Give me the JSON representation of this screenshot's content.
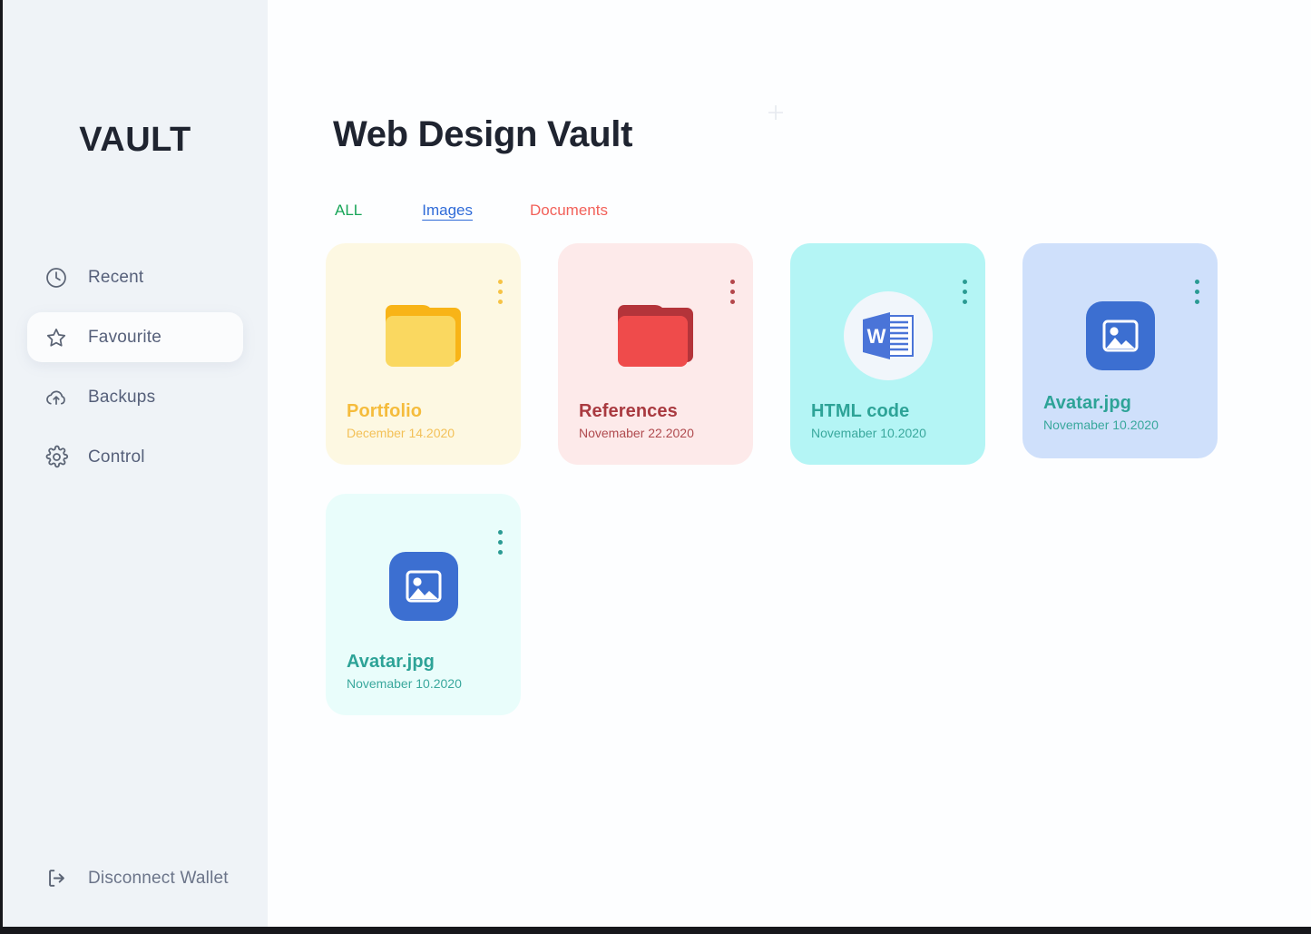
{
  "sidebar": {
    "brand": "VAULT",
    "items": [
      {
        "label": "Recent",
        "icon": "clock-icon",
        "active": false
      },
      {
        "label": "Favourite",
        "icon": "star-icon",
        "active": true
      },
      {
        "label": "Backups",
        "icon": "cloud-upload-icon",
        "active": false
      },
      {
        "label": "Control",
        "icon": "gear-icon",
        "active": false
      }
    ],
    "logout": {
      "label": "Disconnect Wallet",
      "icon": "logout-icon"
    }
  },
  "main": {
    "title": "Web Design Vault",
    "tabs": [
      {
        "label": "ALL",
        "color": "#18a558",
        "selected": false
      },
      {
        "label": "Images",
        "color": "#2f6bd8",
        "selected": true
      },
      {
        "label": "Documents",
        "color": "#f2615a",
        "selected": false
      }
    ],
    "cards": [
      {
        "name": "Portfolio",
        "date": "December 14.2020",
        "kind": "folder",
        "card_bg": "#fdf8e2",
        "name_color": "#f5bc3c",
        "date_color": "#f3c158",
        "dots_color": "#f6c344",
        "icon_main": "#fad860",
        "icon_accent": "#f8b417"
      },
      {
        "name": "References",
        "date": "Novemaber 22.2020",
        "kind": "folder",
        "card_bg": "#fdeaea",
        "name_color": "#a93a40",
        "date_color": "#b04b4f",
        "dots_color": "#b4474b",
        "icon_main": "#ef4b4b",
        "icon_accent": "#b4343a"
      },
      {
        "name": "HTML code",
        "date": "Novemaber 10.2020",
        "kind": "word",
        "card_bg": "#b4f5f5",
        "name_color": "#2da397",
        "date_color": "#3aa89d",
        "dots_color": "#2b9b93",
        "icon_main": "#4a74d8",
        "icon_accent": "#ffffff"
      },
      {
        "name": "Avatar.jpg",
        "date": "Novemaber 10.2020",
        "kind": "image",
        "card_bg": "#cfe0fb",
        "name_color": "#2da397",
        "date_color": "#3aa89d",
        "dots_color": "#2b9b93",
        "icon_main": "#3c6fd1",
        "icon_accent": "#ffffff"
      },
      {
        "name": "Avatar.jpg",
        "date": "Novemaber 10.2020",
        "kind": "image",
        "card_bg": "#e9fdfb",
        "name_color": "#2da397",
        "date_color": "#3aa89d",
        "dots_color": "#2b9b93",
        "icon_main": "#3c6fd1",
        "icon_accent": "#ffffff"
      }
    ]
  },
  "theme": {
    "sidebar_bg": "#eff3f7",
    "main_bg": "#fdfeff",
    "text_dark": "#1f2430",
    "nav_text": "#56607a",
    "frame": "#17181c"
  }
}
